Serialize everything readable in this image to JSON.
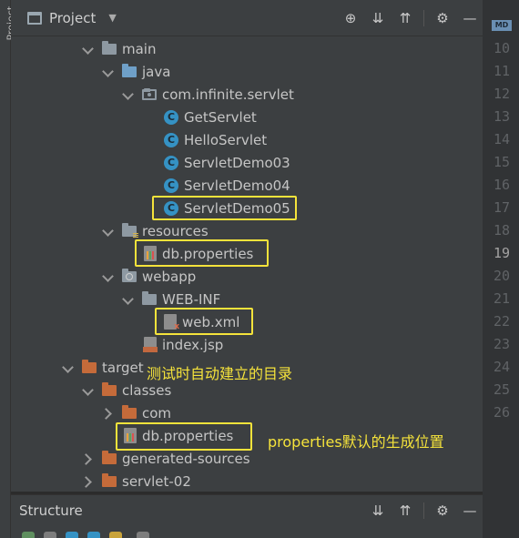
{
  "sidebar": {
    "label": "Project"
  },
  "header": {
    "title": "Project",
    "tools": [
      "crosshair-icon",
      "collapse-all-icon",
      "expand-all-icon",
      "gear-icon",
      "minimize-icon"
    ]
  },
  "tree": {
    "main": "main",
    "java": "java",
    "package": "com.infinite.servlet",
    "classes": [
      "GetServlet",
      "HelloServlet",
      "ServletDemo03",
      "ServletDemo04",
      "ServletDemo05"
    ],
    "resources": "resources",
    "res_props": "db.properties",
    "webapp": "webapp",
    "webinf": "WEB-INF",
    "webxml": "web.xml",
    "indexjsp": "index.jsp",
    "target": "target",
    "target_classes": "classes",
    "com": "com",
    "target_props": "db.properties",
    "generated": "generated-sources",
    "servlet02": "servlet-02"
  },
  "annotations": {
    "auto_created": "测试时自动建立的目录",
    "default_location": "properties默认的生成位置"
  },
  "gutter": {
    "tab": "MD",
    "lines": [
      "10",
      "11",
      "12",
      "13",
      "14",
      "15",
      "16",
      "17",
      "18",
      "19",
      "20",
      "21",
      "22",
      "23",
      "24",
      "25",
      "26"
    ],
    "current": "19"
  },
  "structure": {
    "title": "Structure"
  },
  "colors": {
    "highlight": "#f5e33b",
    "panel": "#3c3f41",
    "class_icon": "#3592c4",
    "folder_orange": "#c56b3a"
  }
}
